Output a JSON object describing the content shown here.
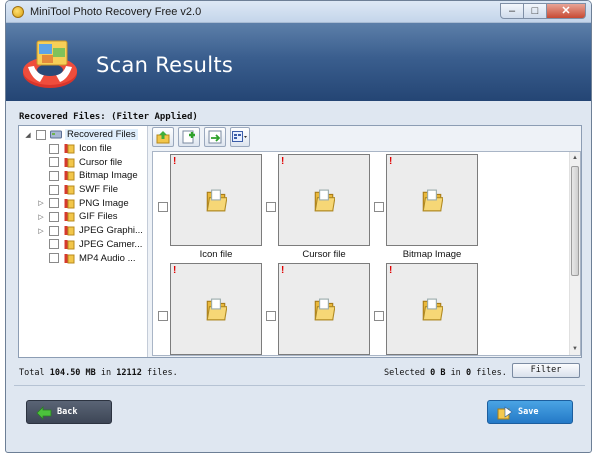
{
  "window": {
    "title": "MiniTool Photo Recovery Free v2.0",
    "controls": {
      "minimize": "–",
      "maximize": "□",
      "close": "✕"
    }
  },
  "banner": {
    "title": "Scan Results"
  },
  "filter_label": "Recovered Files: (Filter Applied)",
  "tree": {
    "root": "Recovered Files",
    "items": [
      {
        "label": "Icon file",
        "expandable": false
      },
      {
        "label": "Cursor file",
        "expandable": false
      },
      {
        "label": "Bitmap Image",
        "expandable": false
      },
      {
        "label": "SWF File",
        "expandable": false
      },
      {
        "label": "PNG Image",
        "expandable": true
      },
      {
        "label": "GIF Files",
        "expandable": true
      },
      {
        "label": "JPEG Graphi...",
        "expandable": true
      },
      {
        "label": "JPEG Camer...",
        "expandable": false
      },
      {
        "label": "MP4 Audio ...",
        "expandable": false
      }
    ]
  },
  "toolbar": {
    "icons": [
      "up-folder-icon",
      "add-icon",
      "export-icon",
      "view-mode-icon"
    ]
  },
  "thumbnails": [
    {
      "caption": "Icon file",
      "flag": "!"
    },
    {
      "caption": "Cursor file",
      "flag": "!"
    },
    {
      "caption": "Bitmap Image",
      "flag": "!"
    },
    {
      "caption": "",
      "flag": "!"
    },
    {
      "caption": "",
      "flag": "!"
    },
    {
      "caption": "",
      "flag": "!"
    }
  ],
  "status": {
    "total_prefix": "Total",
    "total_size": "104.50 MB",
    "total_in": "in",
    "total_count": "12112",
    "total_suffix": "files.",
    "selected_prefix": "Selected",
    "selected_size": "0 B",
    "selected_in": "in",
    "selected_count": "0",
    "selected_suffix": "files."
  },
  "buttons": {
    "filter": "Filter",
    "back": "Back",
    "save": "Save"
  },
  "colors": {
    "banner": "#3a5e8e",
    "save": "#2479c7",
    "back": "#4a5363",
    "flag": "#e00000"
  }
}
